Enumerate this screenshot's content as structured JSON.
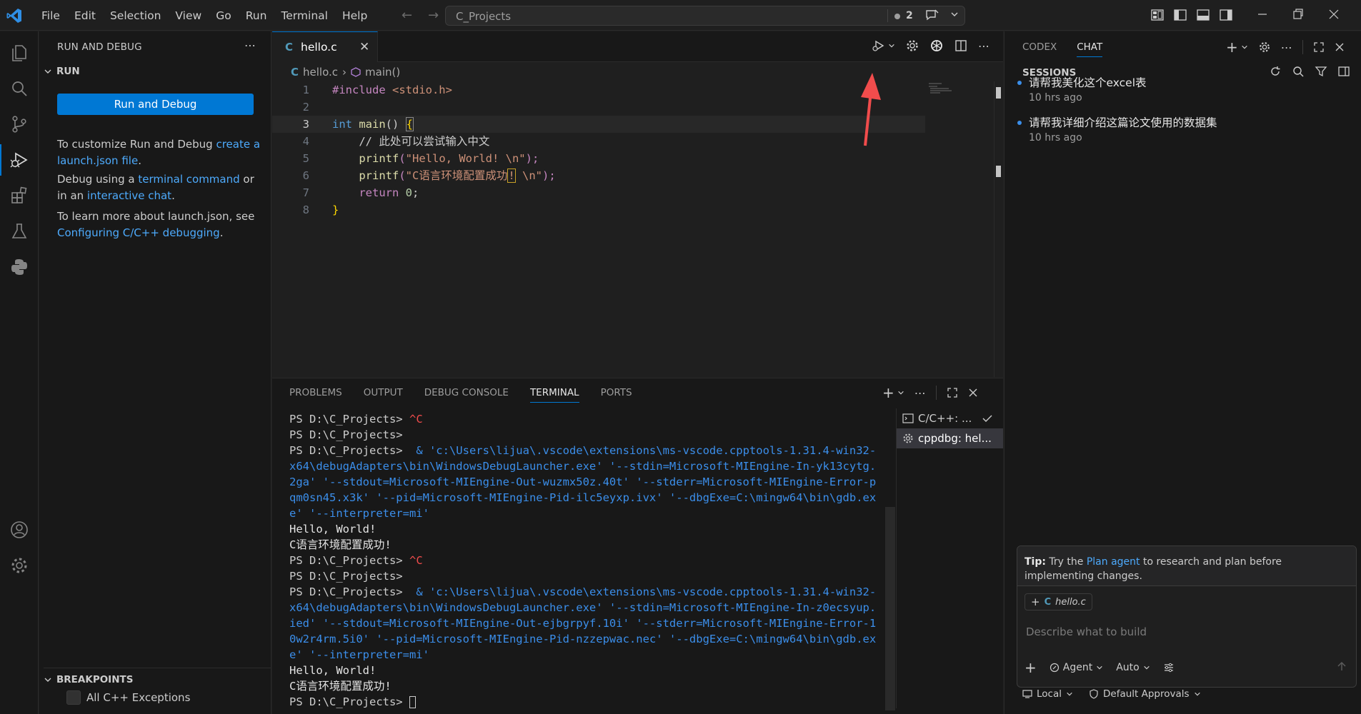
{
  "titlebar": {
    "menu": [
      "File",
      "Edit",
      "Selection",
      "View",
      "Go",
      "Run",
      "Terminal",
      "Help"
    ],
    "command_center": "C_Projects",
    "problem_count": "2"
  },
  "activity_bar": {
    "icons": [
      "explorer-icon",
      "search-icon",
      "source-control-icon",
      "run-debug-icon",
      "extensions-icon",
      "testing-icon",
      "python-icon",
      "account-icon",
      "settings-gear-icon"
    ]
  },
  "sidebar": {
    "title": "RUN AND DEBUG",
    "section": "RUN",
    "run_button": "Run and Debug",
    "p1_text": "To customize Run and Debug ",
    "p1_link": "create a launch.json file",
    "p1_end": ".",
    "p2_text": "Debug using a ",
    "p2_link1": "terminal command",
    "p2_mid": " or in an ",
    "p2_link2": "interactive chat",
    "p2_end": ".",
    "p3_text": "To learn more about launch.json, see ",
    "p3_link": "Configuring C/C++ debugging",
    "p3_end": ".",
    "breakpoints_header": "BREAKPOINTS",
    "breakpoint_item": "All C++ Exceptions"
  },
  "editor": {
    "tab_icon": "C",
    "tab_name": "hello.c",
    "breadcrumb_file": "hello.c",
    "breadcrumb_symbol": "main()",
    "line_numbers": [
      "1",
      "2",
      "3",
      "4",
      "5",
      "6",
      "7",
      "8"
    ],
    "code": {
      "l1_pp": "#include",
      "l1_inc": " <stdio.h>",
      "l3_kw": "int",
      "l3_fn": " main",
      "l3_rest": "() ",
      "l3_brace": "{",
      "l4": "    // 此处可以尝试输入中文",
      "l5_fn": "    printf",
      "l5_open": "(",
      "l5_str": "\"Hello, World! \\n\"",
      "l5_close": ");",
      "l6_fn": "    printf",
      "l6_open": "(",
      "l6_str_a": "\"C语言环境配置成功",
      "l6_str_box": "!",
      "l6_str_b": " \\n\"",
      "l6_close": ");",
      "l7_kw": "    return",
      "l7_num": " 0",
      "l7_end": ";",
      "l8_brace": "}"
    }
  },
  "panel": {
    "tabs": [
      "PROBLEMS",
      "OUTPUT",
      "DEBUG CONSOLE",
      "TERMINAL",
      "PORTS"
    ],
    "active_tab": "TERMINAL",
    "terminal_lines": [
      {
        "prompt": "PS D:\\C_Projects> ",
        "rest": "^C",
        "cls": "y"
      },
      {
        "prompt": "PS D:\\C_Projects>",
        "rest": "",
        "cls": ""
      },
      {
        "prompt": "PS D:\\C_Projects> ",
        "rest": " & 'c:\\Users\\lijua\\.vscode\\extensions\\ms-vscode.cpptools-1.31.4-win32-x64\\debugAdapters\\bin\\WindowsDebugLauncher.exe' '--stdin=Microsoft-MIEngine-In-yk13cytg.2ga' '--stdout=Microsoft-MIEngine-Out-wuzmx50z.40t' '--stderr=Microsoft-MIEngine-Error-pqm0sn45.x3k' '--pid=Microsoft-MIEngine-Pid-ilc5eyxp.ivx' '--dbgExe=C:\\mingw64\\bin\\gdb.exe' '--interpreter=mi'",
        "cls": "b"
      },
      {
        "prompt": "",
        "rest": "Hello, World!",
        "cls": "w"
      },
      {
        "prompt": "",
        "rest": "C语言环境配置成功!",
        "cls": "w"
      },
      {
        "prompt": "PS D:\\C_Projects> ",
        "rest": "^C",
        "cls": "y"
      },
      {
        "prompt": "PS D:\\C_Projects>",
        "rest": "",
        "cls": ""
      },
      {
        "prompt": "PS D:\\C_Projects> ",
        "rest": " & 'c:\\Users\\lijua\\.vscode\\extensions\\ms-vscode.cpptools-1.31.4-win32-x64\\debugAdapters\\bin\\WindowsDebugLauncher.exe' '--stdin=Microsoft-MIEngine-In-z0ecsyup.ied' '--stdout=Microsoft-MIEngine-Out-ejbgrpyf.10i' '--stderr=Microsoft-MIEngine-Error-10w2r4rm.5i0' '--pid=Microsoft-MIEngine-Pid-nzzepwac.nec' '--dbgExe=C:\\mingw64\\bin\\gdb.exe' '--interpreter=mi'",
        "cls": "b"
      },
      {
        "prompt": "",
        "rest": "Hello, World!",
        "cls": "w"
      },
      {
        "prompt": "",
        "rest": "C语言环境配置成功!",
        "cls": "w"
      },
      {
        "prompt": "PS D:\\C_Projects> ",
        "rest": "",
        "cls": ""
      }
    ],
    "terminal_instances": [
      "C/C++: ...",
      "cppdbg: hel..."
    ]
  },
  "chat": {
    "tabs": [
      "CODEX",
      "CHAT"
    ],
    "active_tab": "CHAT",
    "sessions_header": "SESSIONS",
    "sessions": [
      {
        "title": "请帮我美化这个excel表",
        "time": "10 hrs ago"
      },
      {
        "title": "请帮我详细介绍这篇论文使用的数据集",
        "time": "10 hrs ago"
      }
    ],
    "tip_label": "Tip:",
    "tip_pre": " Try the ",
    "tip_link": "Plan agent",
    "tip_post": " to research and plan before implementing changes.",
    "context_chip_icon": "C",
    "context_chip_file": "hello.c",
    "input_placeholder": "Describe what to build",
    "mode": "Agent",
    "model": "Auto",
    "footer_location": "Local",
    "footer_approvals": "Default Approvals"
  },
  "colors": {
    "accent": "#0078d4",
    "link": "#4daafc",
    "annotation_arrow": "#f14c4c"
  }
}
